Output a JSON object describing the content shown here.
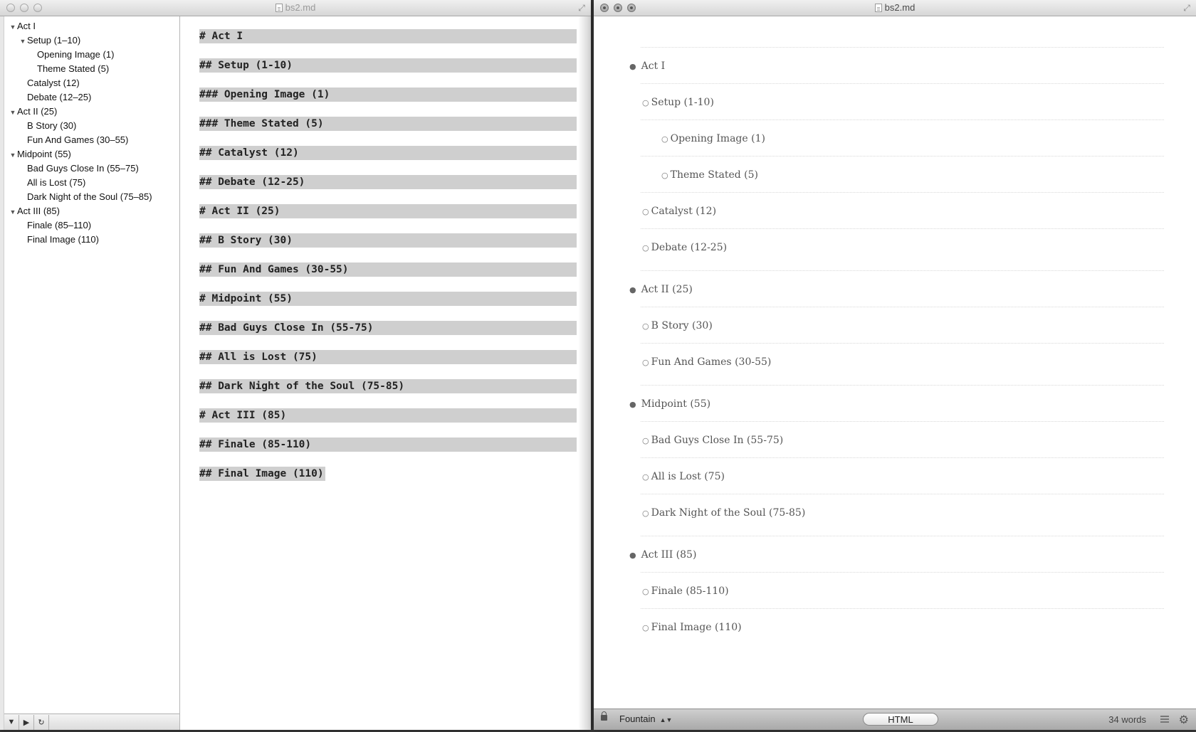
{
  "left_window": {
    "title": "bs2.md",
    "outline": [
      {
        "label": "Act I",
        "level": 0,
        "expanded": true
      },
      {
        "label": "Setup (1–10)",
        "level": 1,
        "expanded": true
      },
      {
        "label": "Opening Image (1)",
        "level": 2
      },
      {
        "label": "Theme Stated (5)",
        "level": 2
      },
      {
        "label": "Catalyst (12)",
        "level": 1
      },
      {
        "label": "Debate (12–25)",
        "level": 1
      },
      {
        "label": "Act II (25)",
        "level": 0,
        "expanded": true
      },
      {
        "label": "B Story (30)",
        "level": 1
      },
      {
        "label": "Fun And Games (30–55)",
        "level": 1
      },
      {
        "label": "Midpoint (55)",
        "level": 0,
        "expanded": true
      },
      {
        "label": "Bad Guys Close In (55–75)",
        "level": 1
      },
      {
        "label": "All is Lost (75)",
        "level": 1
      },
      {
        "label": "Dark Night of the Soul (75–85)",
        "level": 1
      },
      {
        "label": "Act III (85)",
        "level": 0,
        "expanded": true
      },
      {
        "label": "Finale (85–110)",
        "level": 1
      },
      {
        "label": "Final Image (110)",
        "level": 1
      }
    ],
    "editor_lines": [
      "# Act I",
      "## Setup (1-10)",
      "### Opening Image (1)",
      "### Theme Stated (5)",
      "## Catalyst (12)",
      "## Debate (12-25)",
      "# Act II (25)",
      "## B Story (30)",
      "## Fun And Games (30-55)",
      "# Midpoint (55)",
      "## Bad Guys Close In (55-75)",
      "## All is Lost (75)",
      "## Dark Night of the Soul (75-85)",
      "# Act III (85)",
      "## Finale (85-110)",
      "## Final Image (110)"
    ]
  },
  "right_window": {
    "title": "bs2.md",
    "preview_items": [
      {
        "label": "Act I",
        "level": 0
      },
      {
        "label": "Setup (1-10)",
        "level": 1
      },
      {
        "label": "Opening Image (1)",
        "level": 2
      },
      {
        "label": "Theme Stated (5)",
        "level": 2
      },
      {
        "label": "Catalyst (12)",
        "level": 1
      },
      {
        "label": "Debate (12-25)",
        "level": 1
      },
      {
        "label": "Act II (25)",
        "level": 0
      },
      {
        "label": "B Story (30)",
        "level": 1
      },
      {
        "label": "Fun And Games (30-55)",
        "level": 1
      },
      {
        "label": "Midpoint (55)",
        "level": 0
      },
      {
        "label": "Bad Guys Close In (55-75)",
        "level": 1
      },
      {
        "label": "All is Lost (75)",
        "level": 1
      },
      {
        "label": "Dark Night of the Soul (75-85)",
        "level": 1
      },
      {
        "label": "Act III (85)",
        "level": 0
      },
      {
        "label": "Finale (85-110)",
        "level": 1
      },
      {
        "label": "Final Image (110)",
        "level": 1
      }
    ],
    "status": {
      "mode": "Fountain",
      "html_button": "HTML",
      "word_count": "34 words"
    }
  }
}
